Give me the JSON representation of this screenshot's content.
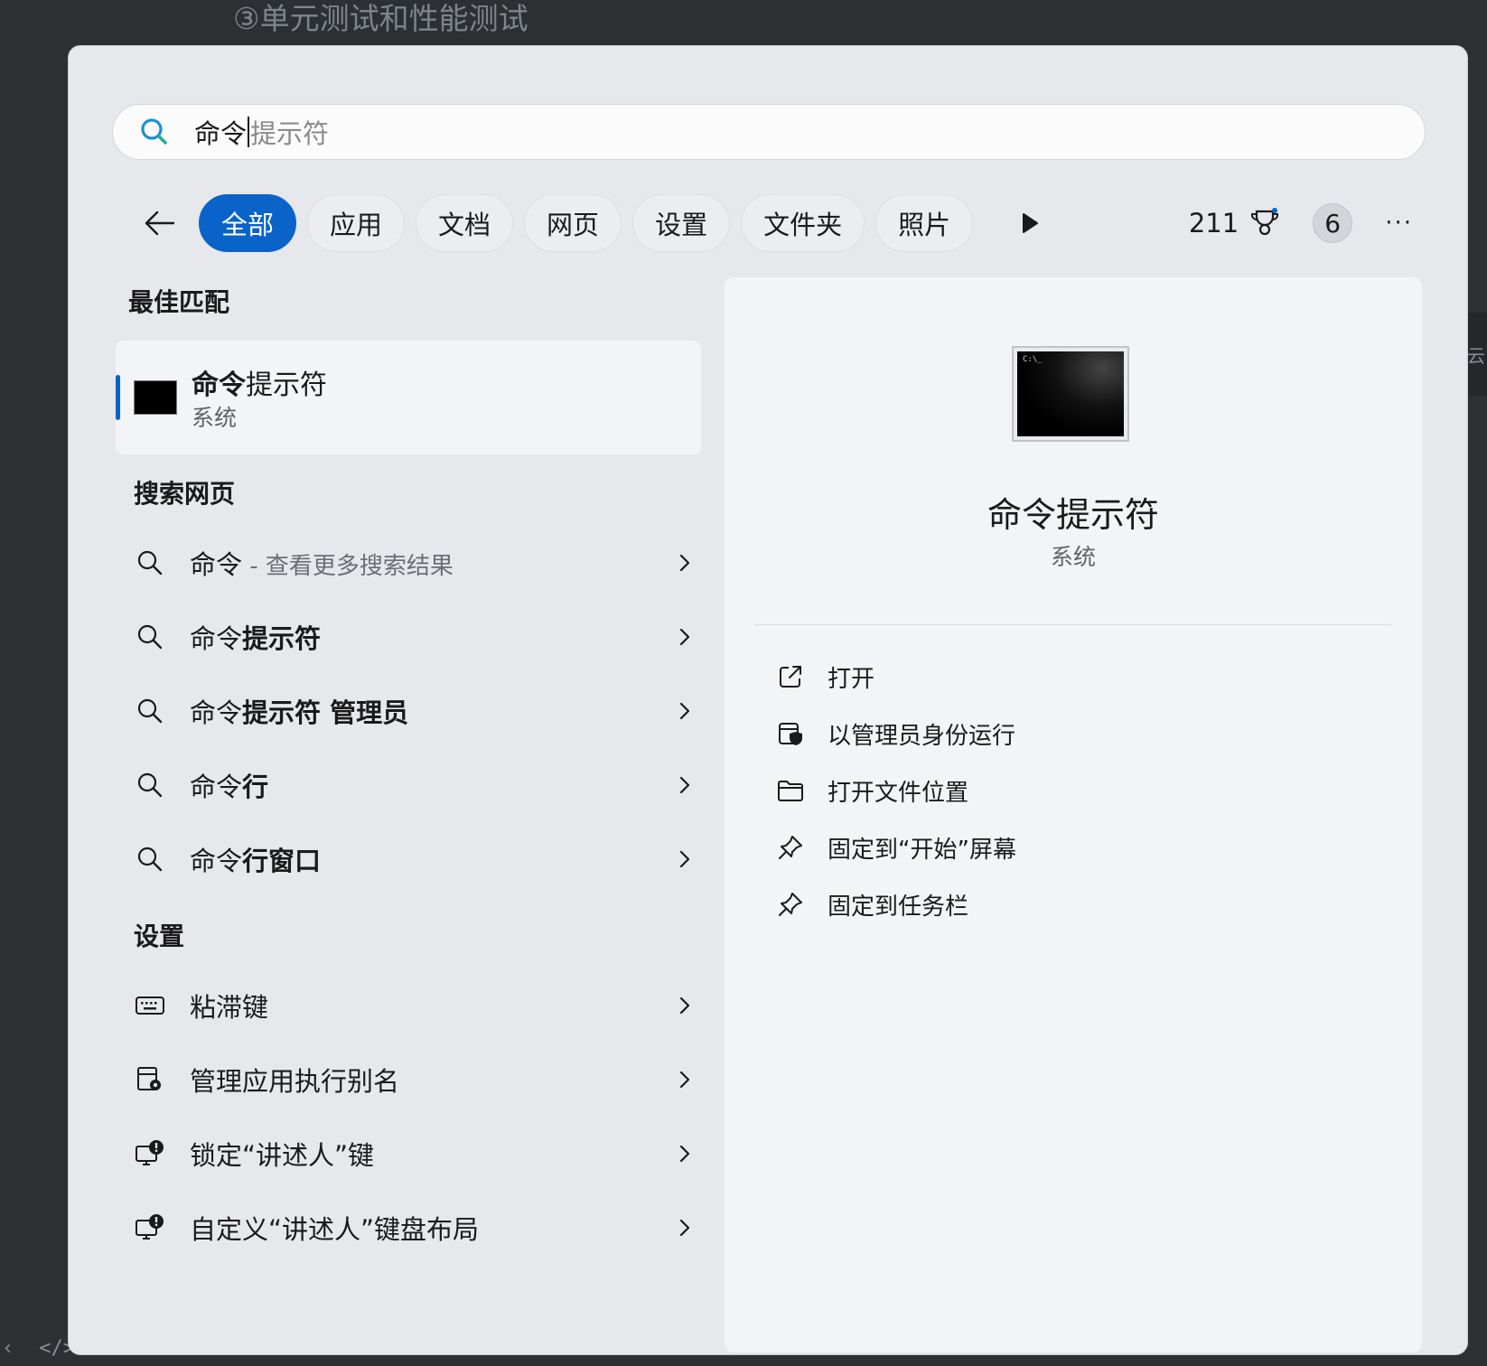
{
  "background": {
    "title": "③单元测试和性能测试",
    "side_tab": "云",
    "bottom_left": [
      "‹",
      "</>"
    ]
  },
  "search": {
    "typed": "命令",
    "suggestion": "提示符"
  },
  "filters": {
    "chips": [
      {
        "label": "全部",
        "active": true
      },
      {
        "label": "应用",
        "active": false
      },
      {
        "label": "文档",
        "active": false
      },
      {
        "label": "网页",
        "active": false
      },
      {
        "label": "设置",
        "active": false
      },
      {
        "label": "文件夹",
        "active": false
      },
      {
        "label": "照片",
        "active": false
      }
    ],
    "points": "211",
    "badge_count": "6",
    "more": "···"
  },
  "best_match": {
    "header": "最佳匹配",
    "title_bold": "命令",
    "title_rest": "提示符",
    "subtitle": "系统"
  },
  "web_search": {
    "header": "搜索网页",
    "items": [
      {
        "normal": "命令",
        "bold": "",
        "muted": " - 查看更多搜索结果"
      },
      {
        "normal": "命令",
        "bold": "提示符",
        "muted": ""
      },
      {
        "normal": "命令",
        "bold": "提示符 管理员",
        "muted": ""
      },
      {
        "normal": "命令",
        "bold": "行",
        "muted": ""
      },
      {
        "normal": "命令",
        "bold": "行窗口",
        "muted": ""
      }
    ]
  },
  "settings": {
    "header": "设置",
    "items": [
      {
        "label": "粘滞键",
        "icon": "keyboard-icon"
      },
      {
        "label": "管理应用执行别名",
        "icon": "app-settings-icon"
      },
      {
        "label": "锁定“讲述人”键",
        "icon": "narrator-icon"
      },
      {
        "label": "自定义“讲述人”键盘布局",
        "icon": "narrator-icon"
      }
    ]
  },
  "detail": {
    "title": "命令提示符",
    "subtitle": "系统",
    "icon_text": "C:\\_",
    "actions": [
      {
        "label": "打开",
        "icon": "open-external-icon"
      },
      {
        "label": "以管理员身份运行",
        "icon": "shield-icon"
      },
      {
        "label": "打开文件位置",
        "icon": "folder-icon"
      },
      {
        "label": "固定到“开始”屏幕",
        "icon": "pin-icon"
      },
      {
        "label": "固定到任务栏",
        "icon": "pin-icon"
      }
    ]
  },
  "colors": {
    "accent": "#0a63c9",
    "window_bg": "#e6e8eb",
    "panel_bg": "#f3f4f6"
  }
}
